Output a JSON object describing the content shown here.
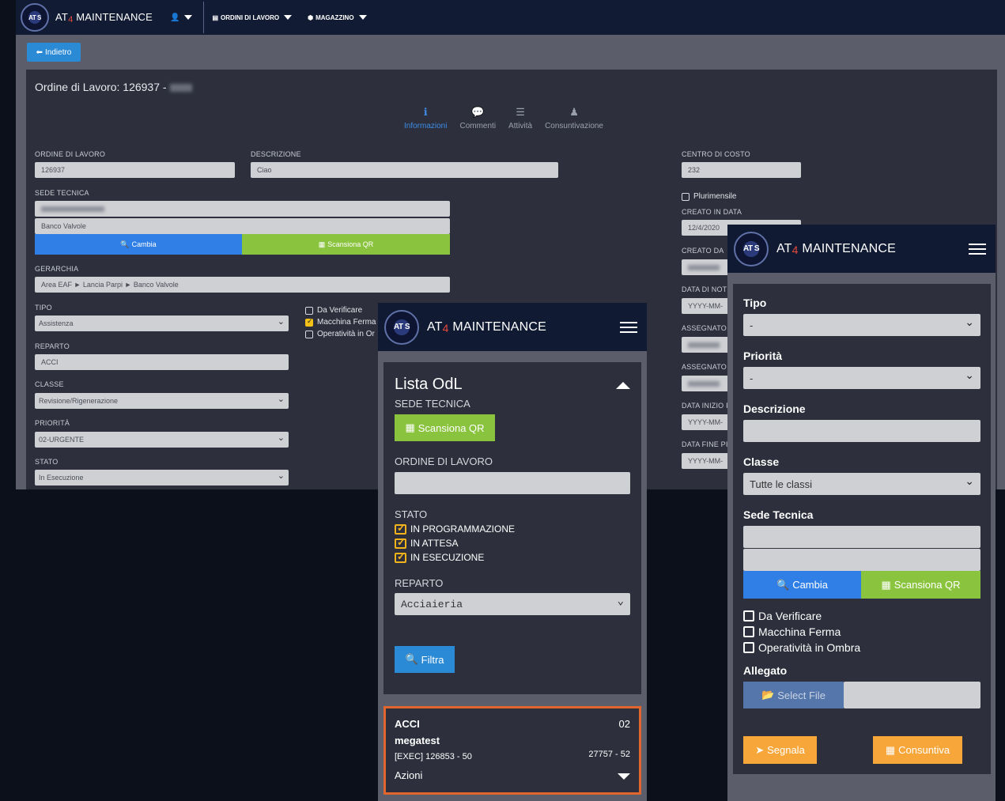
{
  "app": {
    "brand_prefix": "AT",
    "brand_sub": "4",
    "brand_suffix": " MAINTENANCE",
    "logo_text": "AT S",
    "accent_blue": "#2b8ad6",
    "accent_green": "#8ac43e",
    "accent_orange": "#f7a63a"
  },
  "desktop": {
    "nav": {
      "user_icon": "user-icon",
      "orders_label": "ORDINI DI LAVORO",
      "warehouse_label": "MAGAZZINO"
    },
    "back_label": "Indietro",
    "title": "Ordine di Lavoro: 126937 -",
    "tabs": [
      {
        "icon": "info-icon",
        "label": "Informazioni",
        "active": true
      },
      {
        "icon": "comment-icon",
        "label": "Commenti",
        "active": false
      },
      {
        "icon": "list-icon",
        "label": "Attività",
        "active": false
      },
      {
        "icon": "person-icon",
        "label": "Consuntivazione",
        "active": false
      }
    ],
    "fields": {
      "ordine_label": "ORDINE DI LAVORO",
      "ordine_value": "126937",
      "descrizione_label": "DESCRIZIONE",
      "descrizione_value": "Ciao",
      "centro_label": "CENTRO DI COSTO",
      "centro_value": "232",
      "sede_label": "SEDE TECNICA",
      "sede_value2": "Banco Valvole",
      "cambia_label": "Cambia",
      "scansiona_label": "Scansiona QR",
      "gerarchia_label": "GERARCHIA",
      "gerarchia_value": "Area EAF ► Lancia Parpi ► Banco Valvole",
      "tipo_label": "TIPO",
      "tipo_value": "Assistenza",
      "reparto_label": "REPARTO",
      "reparto_value": "ACCI",
      "classe_label": "CLASSE",
      "classe_value": "Revisione/Rigenerazione",
      "priorita_label": "PRIORITÀ",
      "priorita_value": "02-URGENTE",
      "stato_label": "STATO",
      "stato_value": "In Esecuzione",
      "check_verificare": "Da Verificare",
      "check_macchina": "Macchina Ferma",
      "check_operativita": "Operatività in Or",
      "plurimensile": "Plurimensile",
      "creato_data_label": "CREATO IN DATA",
      "creato_data_value": "12/4/2020",
      "creato_da_label": "CREATO DA",
      "data_notif_label": "DATA DI NOTI",
      "date_placeholder": "YYYY-MM-",
      "assegnato_label": "ASSEGNATO D",
      "assegnato_a_label": "ASSEGNATO A",
      "data_inizio_label": "DATA INIZIO P",
      "data_fine_label": "DATA FINE PIA"
    }
  },
  "phone1": {
    "title": "Lista OdL",
    "sede_label": "SEDE TECNICA",
    "scan_label": "Scansiona QR",
    "ordine_label": "ORDINE DI LAVORO",
    "stato_label": "STATO",
    "stati": [
      "IN PROGRAMMAZIONE",
      "IN ATTESA",
      "IN ESECUZIONE"
    ],
    "reparto_label": "REPARTO",
    "reparto_value": "Acciaieria",
    "filtra_label": "Filtra",
    "result": {
      "reparto": "ACCI",
      "priorita": "02",
      "desc": "megatest",
      "code": "[EXEC] 126853 - 50",
      "ref": "27757 - 52",
      "azioni": "Azioni"
    }
  },
  "phone2": {
    "tipo_label": "Tipo",
    "tipo_value": "-",
    "priorita_label": "Priorità",
    "priorita_value": "-",
    "descrizione_label": "Descrizione",
    "classe_label": "Classe",
    "classe_value": "Tutte le classi",
    "sede_label": "Sede Tecnica",
    "cambia_label": "Cambia",
    "scan_label": "Scansiona QR",
    "checks": [
      "Da Verificare",
      "Macchina Ferma",
      "Operatività in Ombra"
    ],
    "allegato_label": "Allegato",
    "select_file": "Select File",
    "segnala_label": "Segnala",
    "consuntiva_label": "Consuntiva"
  }
}
